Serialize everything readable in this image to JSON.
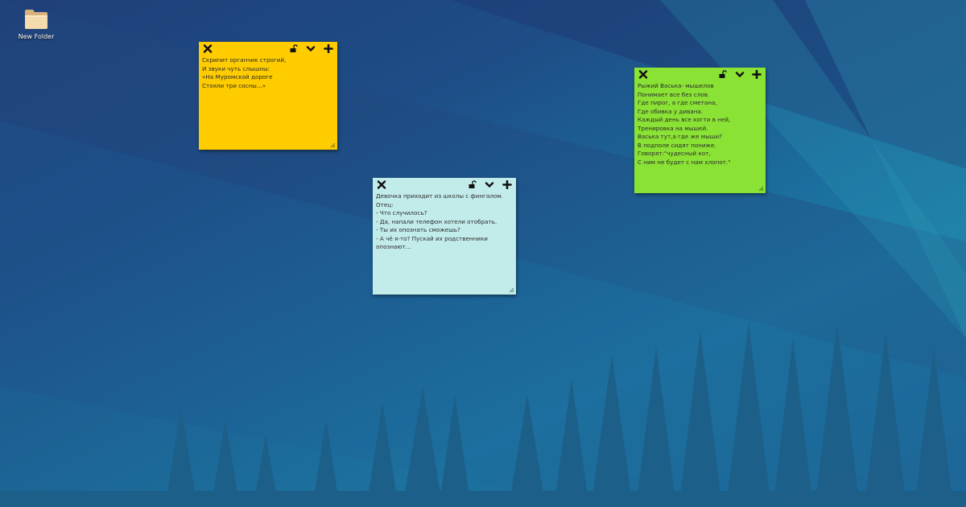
{
  "desktop": {
    "icons": [
      {
        "label": "New Folder",
        "icon": "folder-icon"
      }
    ]
  },
  "notes": [
    {
      "id": "yellow",
      "color": "#ffcc00",
      "lines": [
        "Скрипит органчик строгий,",
        "И звуки чуть слышны:",
        "«На Муромской дороге",
        "Стояли три сосны...»"
      ]
    },
    {
      "id": "cyan",
      "color": "#c2ecea",
      "lines": [
        "Девочка приходит из школы с фингалом.",
        "Отец:",
        "- Что случилось?",
        "- Да, напали телефон хотели отобрать.",
        "- Ты их опознать сможешь?",
        "- А чё я-то? Пускай их родственники",
        "опознают..."
      ]
    },
    {
      "id": "green",
      "color": "#8ae234",
      "lines": [
        "Рыжий Васька- мышелов",
        "Понимает все без слов.",
        "Где пирог, а где сметана,",
        "Где обивка у дивана.",
        "Каждый день все когти в ней,",
        "Тренировка на мышей.",
        "Васька тут,а где же мыши?",
        "В подполе сидят пониже.",
        "Говорят:\"чудесный кот,",
        "С ним не будет с нам хлопот.\""
      ]
    }
  ],
  "note_toolbar_icons": [
    "close-icon",
    "lock-icon",
    "chevron-down-icon",
    "add-icon"
  ]
}
